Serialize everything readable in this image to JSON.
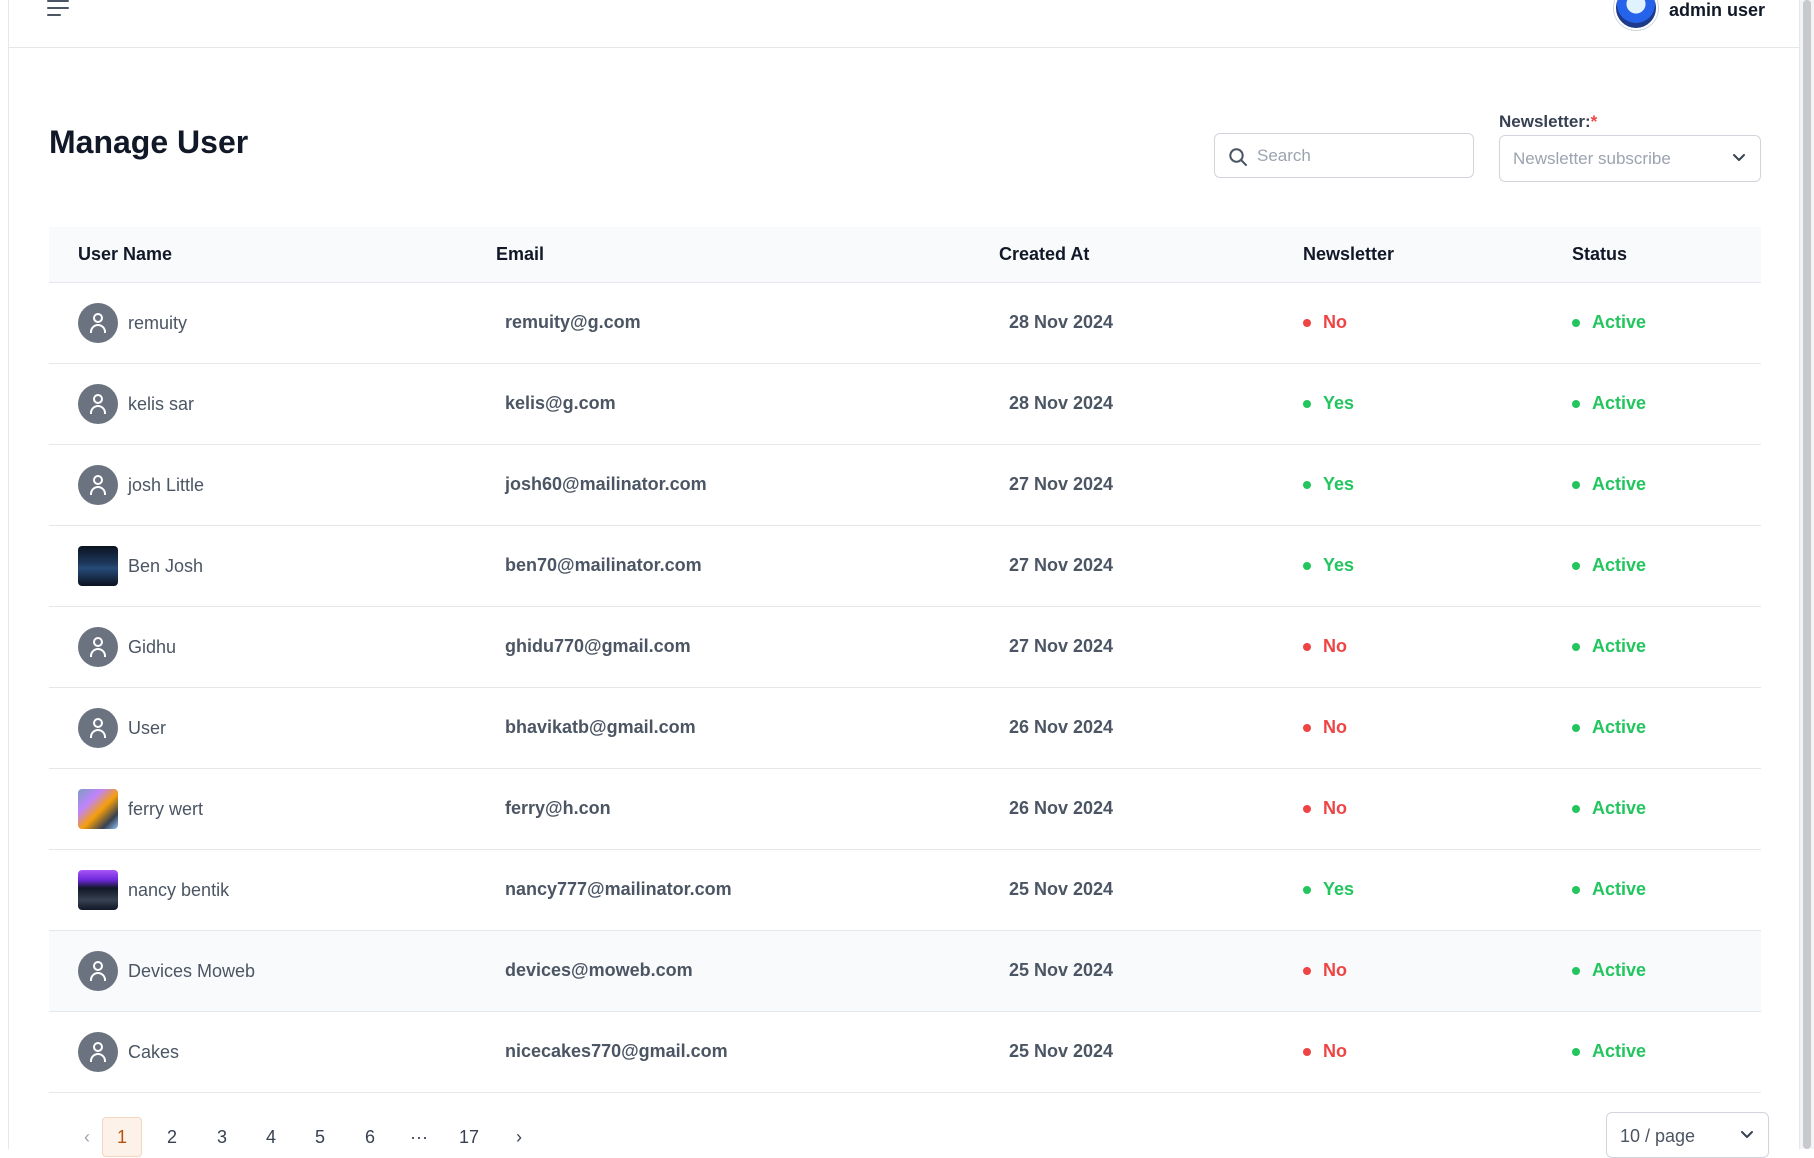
{
  "header": {
    "admin_name": "admin user"
  },
  "page": {
    "title": "Manage User"
  },
  "search": {
    "placeholder": "Search"
  },
  "newsletter_filter": {
    "label": "Newsletter:",
    "required_mark": "*",
    "placeholder": "Newsletter subscribe"
  },
  "table": {
    "headers": [
      "User Name",
      "Email",
      "Created At",
      "Newsletter",
      "Status"
    ],
    "rows": [
      {
        "name": "remuity",
        "email": "remuity@g.com",
        "created": "28 Nov 2024",
        "newsletter": "No",
        "status": "Active",
        "avatar": "default"
      },
      {
        "name": "kelis sar",
        "email": "kelis@g.com",
        "created": "28 Nov 2024",
        "newsletter": "Yes",
        "status": "Active",
        "avatar": "default"
      },
      {
        "name": "josh Little",
        "email": "josh60@mailinator.com",
        "created": "27 Nov 2024",
        "newsletter": "Yes",
        "status": "Active",
        "avatar": "default"
      },
      {
        "name": "Ben Josh",
        "email": "ben70@mailinator.com",
        "created": "27 Nov 2024",
        "newsletter": "Yes",
        "status": "Active",
        "avatar": "photo"
      },
      {
        "name": "Gidhu",
        "email": "ghidu770@gmail.com",
        "created": "27 Nov 2024",
        "newsletter": "No",
        "status": "Active",
        "avatar": "default"
      },
      {
        "name": "User",
        "email": "bhavikatb@gmail.com",
        "created": "26 Nov 2024",
        "newsletter": "No",
        "status": "Active",
        "avatar": "default"
      },
      {
        "name": "ferry wert",
        "email": "ferry@h.con",
        "created": "26 Nov 2024",
        "newsletter": "No",
        "status": "Active",
        "avatar": "photo"
      },
      {
        "name": "nancy bentik",
        "email": "nancy777@mailinator.com",
        "created": "25 Nov 2024",
        "newsletter": "Yes",
        "status": "Active",
        "avatar": "photo"
      },
      {
        "name": "Devices Moweb",
        "email": "devices@moweb.com",
        "created": "25 Nov 2024",
        "newsletter": "No",
        "status": "Active",
        "avatar": "default"
      },
      {
        "name": "Cakes",
        "email": "nicecakes770@gmail.com",
        "created": "25 Nov 2024",
        "newsletter": "No",
        "status": "Active",
        "avatar": "default"
      }
    ]
  },
  "pagination": {
    "prev": "‹",
    "pages": [
      "1",
      "2",
      "3",
      "4",
      "5",
      "6"
    ],
    "ellipsis": "···",
    "last": "17",
    "next": "›",
    "current": "1",
    "page_size": "10 / page"
  },
  "colors": {
    "no": "#ef4444",
    "yes": "#22c55e",
    "active": "#22c55e",
    "current_page_bg": "#fdf2e9"
  },
  "icons": {
    "menu": "hamburger-menu-icon",
    "search": "search-icon",
    "dropdown": "chevron-down-icon",
    "avatar": "user-icon"
  }
}
